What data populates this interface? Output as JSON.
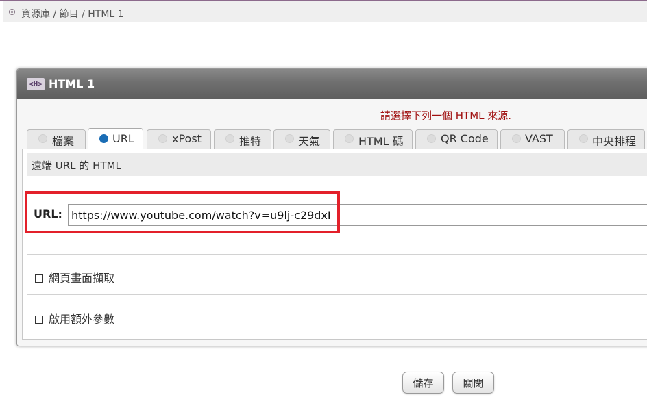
{
  "breadcrumb": "資源庫 / 節目 / HTML 1",
  "dialog": {
    "title": "HTML 1",
    "title_icon": "<H>",
    "notice": "請選擇下列一個 HTML 來源.",
    "tabs": [
      {
        "label": "檔案",
        "selected": false
      },
      {
        "label": "URL",
        "selected": true
      },
      {
        "label": "xPost",
        "selected": false
      },
      {
        "label": "推特",
        "selected": false
      },
      {
        "label": "天氣",
        "selected": false
      },
      {
        "label": "HTML 碼",
        "selected": false
      },
      {
        "label": "QR Code",
        "selected": false
      },
      {
        "label": "VAST",
        "selected": false
      },
      {
        "label": "中央排程",
        "selected": false
      }
    ],
    "section_title": "遠端 URL 的 HTML",
    "url_label": "URL:",
    "url_value": "https://www.youtube.com/watch?v=u9lj-c29dxI",
    "options": [
      {
        "label": "網頁畫面擷取",
        "checked": false
      },
      {
        "label": "啟用額外參數",
        "checked": false
      }
    ]
  },
  "buttons": {
    "save": "儲存",
    "close": "關閉"
  },
  "colors": {
    "accent": "#e3202a",
    "notice": "#a01010",
    "radio_selected": "#1a6db5"
  }
}
